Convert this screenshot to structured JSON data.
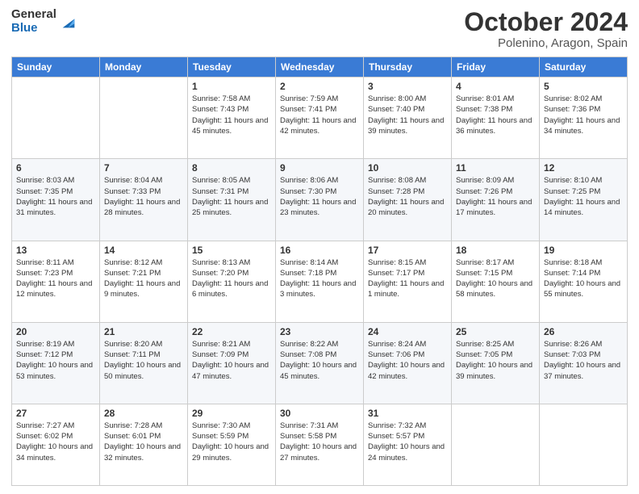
{
  "logo": {
    "general": "General",
    "blue": "Blue"
  },
  "title": {
    "month": "October 2024",
    "location": "Polenino, Aragon, Spain"
  },
  "headers": [
    "Sunday",
    "Monday",
    "Tuesday",
    "Wednesday",
    "Thursday",
    "Friday",
    "Saturday"
  ],
  "weeks": [
    [
      {
        "day": "",
        "sunrise": "",
        "sunset": "",
        "daylight": ""
      },
      {
        "day": "",
        "sunrise": "",
        "sunset": "",
        "daylight": ""
      },
      {
        "day": "1",
        "sunrise": "Sunrise: 7:58 AM",
        "sunset": "Sunset: 7:43 PM",
        "daylight": "Daylight: 11 hours and 45 minutes."
      },
      {
        "day": "2",
        "sunrise": "Sunrise: 7:59 AM",
        "sunset": "Sunset: 7:41 PM",
        "daylight": "Daylight: 11 hours and 42 minutes."
      },
      {
        "day": "3",
        "sunrise": "Sunrise: 8:00 AM",
        "sunset": "Sunset: 7:40 PM",
        "daylight": "Daylight: 11 hours and 39 minutes."
      },
      {
        "day": "4",
        "sunrise": "Sunrise: 8:01 AM",
        "sunset": "Sunset: 7:38 PM",
        "daylight": "Daylight: 11 hours and 36 minutes."
      },
      {
        "day": "5",
        "sunrise": "Sunrise: 8:02 AM",
        "sunset": "Sunset: 7:36 PM",
        "daylight": "Daylight: 11 hours and 34 minutes."
      }
    ],
    [
      {
        "day": "6",
        "sunrise": "Sunrise: 8:03 AM",
        "sunset": "Sunset: 7:35 PM",
        "daylight": "Daylight: 11 hours and 31 minutes."
      },
      {
        "day": "7",
        "sunrise": "Sunrise: 8:04 AM",
        "sunset": "Sunset: 7:33 PM",
        "daylight": "Daylight: 11 hours and 28 minutes."
      },
      {
        "day": "8",
        "sunrise": "Sunrise: 8:05 AM",
        "sunset": "Sunset: 7:31 PM",
        "daylight": "Daylight: 11 hours and 25 minutes."
      },
      {
        "day": "9",
        "sunrise": "Sunrise: 8:06 AM",
        "sunset": "Sunset: 7:30 PM",
        "daylight": "Daylight: 11 hours and 23 minutes."
      },
      {
        "day": "10",
        "sunrise": "Sunrise: 8:08 AM",
        "sunset": "Sunset: 7:28 PM",
        "daylight": "Daylight: 11 hours and 20 minutes."
      },
      {
        "day": "11",
        "sunrise": "Sunrise: 8:09 AM",
        "sunset": "Sunset: 7:26 PM",
        "daylight": "Daylight: 11 hours and 17 minutes."
      },
      {
        "day": "12",
        "sunrise": "Sunrise: 8:10 AM",
        "sunset": "Sunset: 7:25 PM",
        "daylight": "Daylight: 11 hours and 14 minutes."
      }
    ],
    [
      {
        "day": "13",
        "sunrise": "Sunrise: 8:11 AM",
        "sunset": "Sunset: 7:23 PM",
        "daylight": "Daylight: 11 hours and 12 minutes."
      },
      {
        "day": "14",
        "sunrise": "Sunrise: 8:12 AM",
        "sunset": "Sunset: 7:21 PM",
        "daylight": "Daylight: 11 hours and 9 minutes."
      },
      {
        "day": "15",
        "sunrise": "Sunrise: 8:13 AM",
        "sunset": "Sunset: 7:20 PM",
        "daylight": "Daylight: 11 hours and 6 minutes."
      },
      {
        "day": "16",
        "sunrise": "Sunrise: 8:14 AM",
        "sunset": "Sunset: 7:18 PM",
        "daylight": "Daylight: 11 hours and 3 minutes."
      },
      {
        "day": "17",
        "sunrise": "Sunrise: 8:15 AM",
        "sunset": "Sunset: 7:17 PM",
        "daylight": "Daylight: 11 hours and 1 minute."
      },
      {
        "day": "18",
        "sunrise": "Sunrise: 8:17 AM",
        "sunset": "Sunset: 7:15 PM",
        "daylight": "Daylight: 10 hours and 58 minutes."
      },
      {
        "day": "19",
        "sunrise": "Sunrise: 8:18 AM",
        "sunset": "Sunset: 7:14 PM",
        "daylight": "Daylight: 10 hours and 55 minutes."
      }
    ],
    [
      {
        "day": "20",
        "sunrise": "Sunrise: 8:19 AM",
        "sunset": "Sunset: 7:12 PM",
        "daylight": "Daylight: 10 hours and 53 minutes."
      },
      {
        "day": "21",
        "sunrise": "Sunrise: 8:20 AM",
        "sunset": "Sunset: 7:11 PM",
        "daylight": "Daylight: 10 hours and 50 minutes."
      },
      {
        "day": "22",
        "sunrise": "Sunrise: 8:21 AM",
        "sunset": "Sunset: 7:09 PM",
        "daylight": "Daylight: 10 hours and 47 minutes."
      },
      {
        "day": "23",
        "sunrise": "Sunrise: 8:22 AM",
        "sunset": "Sunset: 7:08 PM",
        "daylight": "Daylight: 10 hours and 45 minutes."
      },
      {
        "day": "24",
        "sunrise": "Sunrise: 8:24 AM",
        "sunset": "Sunset: 7:06 PM",
        "daylight": "Daylight: 10 hours and 42 minutes."
      },
      {
        "day": "25",
        "sunrise": "Sunrise: 8:25 AM",
        "sunset": "Sunset: 7:05 PM",
        "daylight": "Daylight: 10 hours and 39 minutes."
      },
      {
        "day": "26",
        "sunrise": "Sunrise: 8:26 AM",
        "sunset": "Sunset: 7:03 PM",
        "daylight": "Daylight: 10 hours and 37 minutes."
      }
    ],
    [
      {
        "day": "27",
        "sunrise": "Sunrise: 7:27 AM",
        "sunset": "Sunset: 6:02 PM",
        "daylight": "Daylight: 10 hours and 34 minutes."
      },
      {
        "day": "28",
        "sunrise": "Sunrise: 7:28 AM",
        "sunset": "Sunset: 6:01 PM",
        "daylight": "Daylight: 10 hours and 32 minutes."
      },
      {
        "day": "29",
        "sunrise": "Sunrise: 7:30 AM",
        "sunset": "Sunset: 5:59 PM",
        "daylight": "Daylight: 10 hours and 29 minutes."
      },
      {
        "day": "30",
        "sunrise": "Sunrise: 7:31 AM",
        "sunset": "Sunset: 5:58 PM",
        "daylight": "Daylight: 10 hours and 27 minutes."
      },
      {
        "day": "31",
        "sunrise": "Sunrise: 7:32 AM",
        "sunset": "Sunset: 5:57 PM",
        "daylight": "Daylight: 10 hours and 24 minutes."
      },
      {
        "day": "",
        "sunrise": "",
        "sunset": "",
        "daylight": ""
      },
      {
        "day": "",
        "sunrise": "",
        "sunset": "",
        "daylight": ""
      }
    ]
  ]
}
